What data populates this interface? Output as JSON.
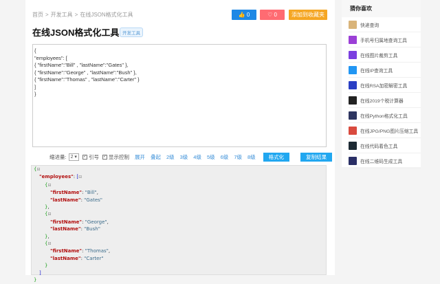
{
  "breadcrumb": [
    "首页",
    ">",
    "开发工具",
    ">",
    "在线JSON格式化工具"
  ],
  "buttons": {
    "like": "👍 0",
    "fav": "♡ 0",
    "add": "添加到收藏夹"
  },
  "title": "在线JSON格式化工具",
  "tag": "开发工具",
  "input_lines": [
    "{",
    "\"employees\": [",
    "{ \"firstName\":\"Bill\" , \"lastName\":\"Gates\" },",
    "{ \"firstName\":\"George\" , \"lastName\":\"Bush\" },",
    "{ \"firstName\":\"Thomas\" , \"lastName\":\"Carter\" }",
    "]",
    "}"
  ],
  "controls": {
    "indent_label": "缩进量:",
    "indent_value": "2 ▾",
    "quote": "引号",
    "show_ctrl": "显示控制",
    "links": [
      "展开",
      "叠起",
      "2级",
      "3级",
      "4级",
      "5级",
      "6级",
      "7级",
      "8级"
    ],
    "format": "格式化",
    "copy": "复制结果"
  },
  "sidebar": {
    "title": "猜你喜欢",
    "items": [
      {
        "label": "快递查询",
        "color": "#d9b47a"
      },
      {
        "label": "手机号归属地查询工具",
        "color": "#9b3fd6"
      },
      {
        "label": "在线图片裁剪工具",
        "color": "#7b3fe0"
      },
      {
        "label": "在线IP查询工具",
        "color": "#2196f3"
      },
      {
        "label": "在线RSA加密解密工具",
        "color": "#2a3fc4"
      },
      {
        "label": "在线2019个税计算器",
        "color": "#222"
      },
      {
        "label": "在线Python格式化工具",
        "color": "#2e3560"
      },
      {
        "label": "在线JPG/PNG图片压缩工具",
        "color": "#d94a3e"
      },
      {
        "label": "在线代码着色工具",
        "color": "#1d2a33"
      },
      {
        "label": "在线二维码生成工具",
        "color": "#2a2f66"
      }
    ]
  }
}
